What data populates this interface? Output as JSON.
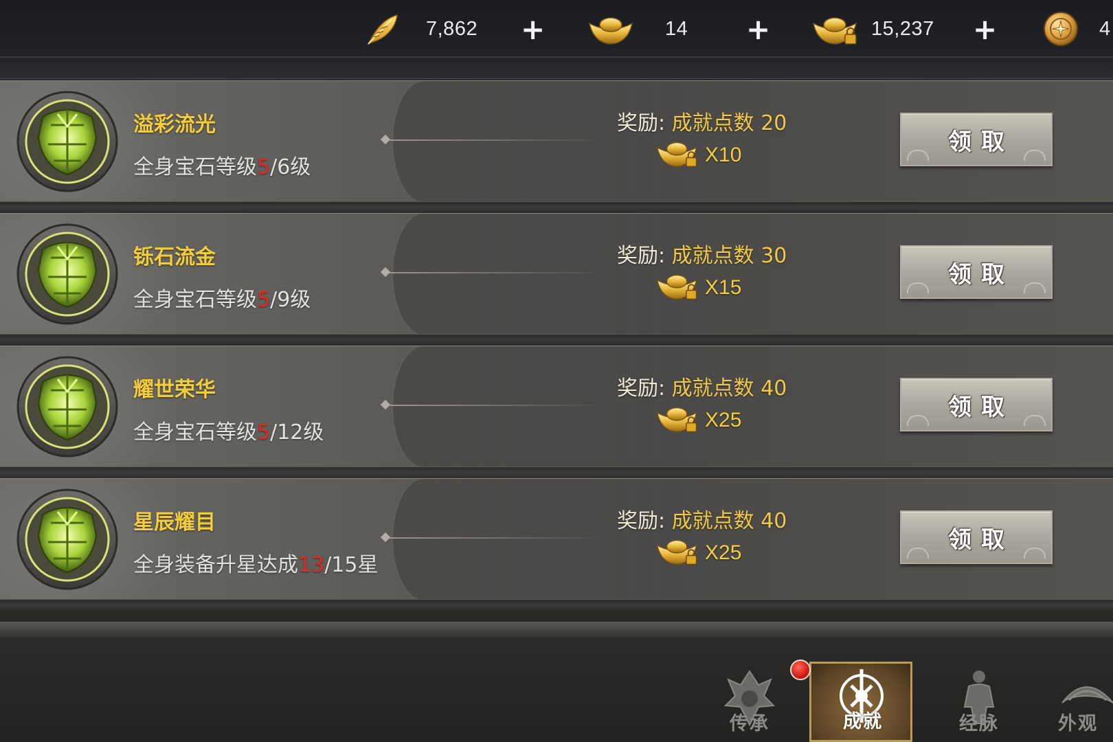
{
  "topbar": {
    "currencies": [
      {
        "icon": "feather-icon",
        "value": "7,862",
        "plus": "+"
      },
      {
        "icon": "gold-ingot-icon",
        "value": "14",
        "plus": "+"
      },
      {
        "icon": "locked-gold-ingot-icon",
        "value": "15,237",
        "plus": "+"
      },
      {
        "icon": "coin-icon",
        "value": "4"
      }
    ]
  },
  "achievements": [
    {
      "title": "溢彩流光",
      "desc_prefix": "全身宝石等级",
      "progress": "5",
      "desc_suffix": "/6级",
      "reward_label": "奖励: ",
      "reward_points": "成就点数 20",
      "reward_qty": "X10",
      "claim_label": "领取"
    },
    {
      "title": "铄石流金",
      "desc_prefix": "全身宝石等级",
      "progress": "5",
      "desc_suffix": "/9级",
      "reward_label": "奖励: ",
      "reward_points": "成就点数 30",
      "reward_qty": "X15",
      "claim_label": "领取"
    },
    {
      "title": "耀世荣华",
      "desc_prefix": "全身宝石等级",
      "progress": "5",
      "desc_suffix": "/12级",
      "reward_label": "奖励: ",
      "reward_points": "成就点数 40",
      "reward_qty": "X25",
      "claim_label": "领取"
    },
    {
      "title": "星辰耀目",
      "desc_prefix": "全身装备升星达成",
      "progress": "13",
      "desc_suffix": "/15星",
      "reward_label": "奖励: ",
      "reward_points": "成就点数 40",
      "reward_qty": "X25",
      "claim_label": "领取"
    }
  ],
  "bottom_nav": {
    "tabs": [
      {
        "label": "传承",
        "icon": "inheritance-icon",
        "active": false
      },
      {
        "label": "成就",
        "icon": "achievement-icon",
        "active": true
      },
      {
        "label": "经脉",
        "icon": "meridian-icon",
        "active": false
      },
      {
        "label": "外观",
        "icon": "appearance-icon",
        "active": false
      }
    ]
  },
  "colors": {
    "title": "#f4cd3a",
    "progress_red": "#e32a22",
    "reward_gold": "#f1c94a",
    "active_tab": "#b99a57"
  }
}
